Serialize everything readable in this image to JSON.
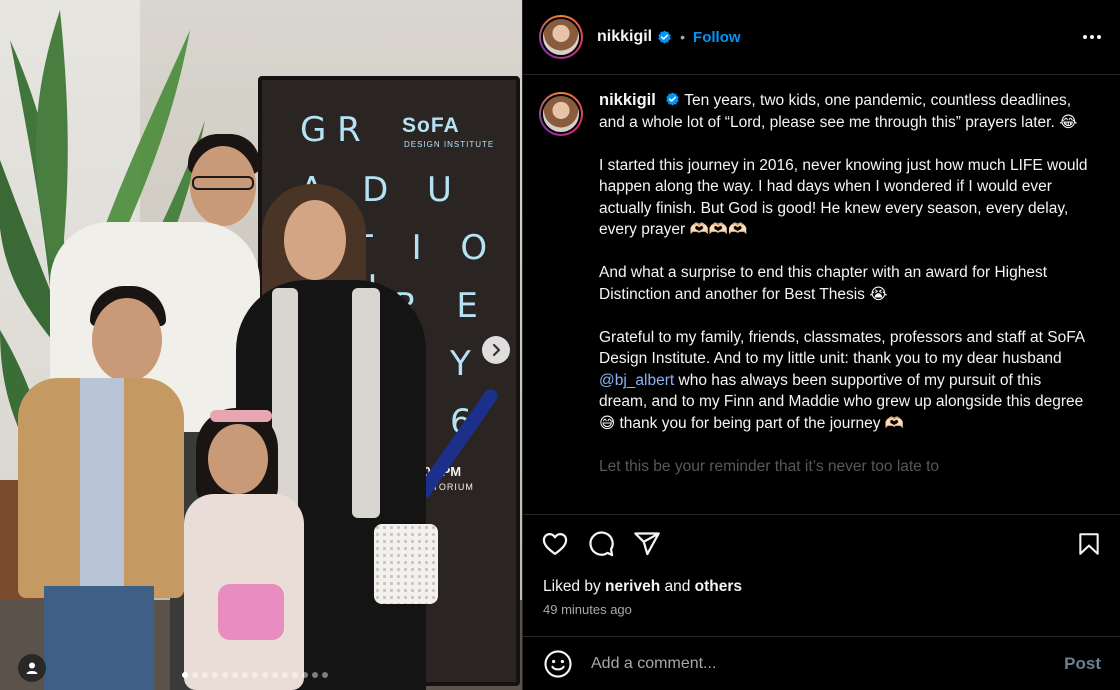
{
  "post": {
    "username": "nikkigil",
    "follow_label": "Follow",
    "separator": "•"
  },
  "photo": {
    "poster_brand": "SoFA",
    "poster_brand_sub": "DESIGN INSTITUTE",
    "poster_letters": [
      "G R",
      "A D U A",
      "T I O N",
      "R E Y",
      "Y",
      "6"
    ],
    "poster_time": "2:00 PM",
    "poster_venue": "UDITORIUM",
    "next_icon": "chevron-right-icon",
    "tag_icon": "user-tag-icon"
  },
  "caption": {
    "username": "nikkigil",
    "p1": " Ten years, two kids, one pandemic, countless deadlines, and a whole lot of “Lord, please see me through this” prayers later. 😂",
    "p2": "I started this journey in 2016, never knowing just how much LIFE would happen along the way. I had days when I wondered if I would ever actually finish. But God is good! He knew every season, every delay, every prayer 🫶🏻🫶🏻🫶🏻",
    "p3": "And what a surprise to end this chapter with an award for Highest Distinction and another for Best Thesis 😭",
    "p4a": "Grateful to my family, friends, classmates, professors and staff at SoFA Design Institute. And to my little unit: thank you to my dear husband ",
    "p4_mention": "@bj_albert",
    "p4b": " who has always been supportive of my pursuit of this dream, and to my Finn and Maddie who grew up alongside this degree 😅 thank you for being part of the journey 🫶🏻",
    "p5": "Let this be your reminder that it’s never too late to"
  },
  "actions": {
    "like_icon": "heart-icon",
    "comment_icon": "comment-icon",
    "share_icon": "send-icon",
    "save_icon": "bookmark-icon"
  },
  "likes": {
    "prefix": "Liked by ",
    "user": "neriveh",
    "middle": " and ",
    "others": "others"
  },
  "time_ago": "49 minutes ago",
  "comment": {
    "placeholder": "Add a comment...",
    "post_label": "Post",
    "emoji_icon": "smiley-icon"
  },
  "colors": {
    "accent": "#0095f6",
    "background": "#000000",
    "mention": "#8ab4f8"
  }
}
